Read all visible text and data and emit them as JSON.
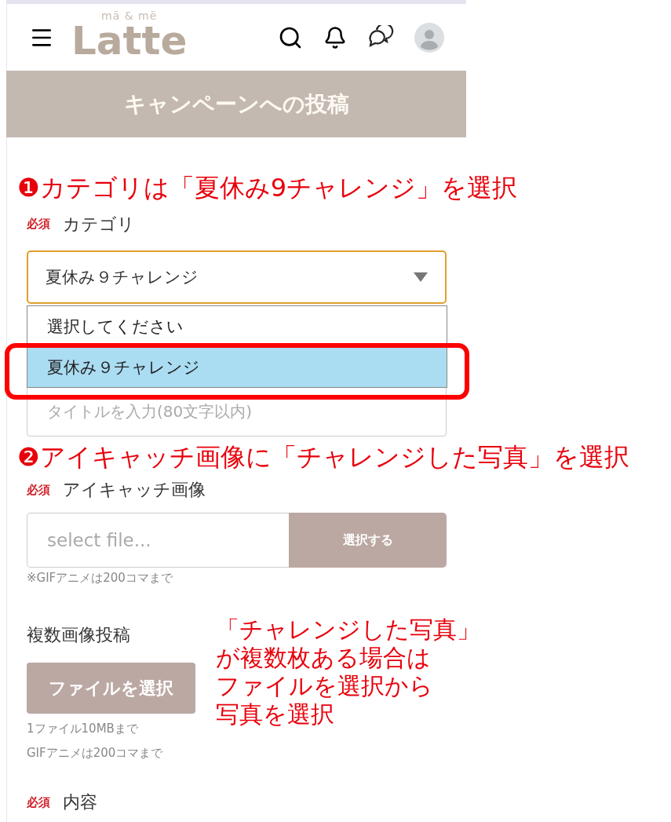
{
  "header": {
    "logo_tagline": "mä & më",
    "logo": "Latte"
  },
  "banner": {
    "title": "キャンペーンへの投稿"
  },
  "annotations": [
    {
      "marker": "❶",
      "text": "カテゴリは「夏休み9チャレンジ」を選択"
    },
    {
      "marker": "❷",
      "text": "アイキャッチ画像に「チャレンジした写真」を選択"
    },
    {
      "lines": [
        "「チャレンジした写真」",
        "が複数枚ある場合は",
        "ファイルを選択から",
        "写真を選択"
      ]
    }
  ],
  "category": {
    "required": "必須",
    "label": "カテゴリ",
    "value": "夏休み９チャレンジ",
    "expanded": true,
    "options": [
      {
        "label": "選択してください",
        "selected": false
      },
      {
        "label": "夏休み９チャレンジ",
        "selected": true
      }
    ]
  },
  "title_field": {
    "placeholder": "タイトルを入力(80文字以内)"
  },
  "eyecatch": {
    "required": "必須",
    "label": "アイキャッチ画像",
    "placeholder": "select file...",
    "button": "選択する",
    "note": "※GIFアニメは200コマまで"
  },
  "multi_image": {
    "label": "複数画像投稿",
    "button": "ファイルを選択",
    "notes": [
      "1ファイル10MBまで",
      "GIFアニメは200コマまで"
    ]
  },
  "content": {
    "required": "必須",
    "label": "内容"
  }
}
